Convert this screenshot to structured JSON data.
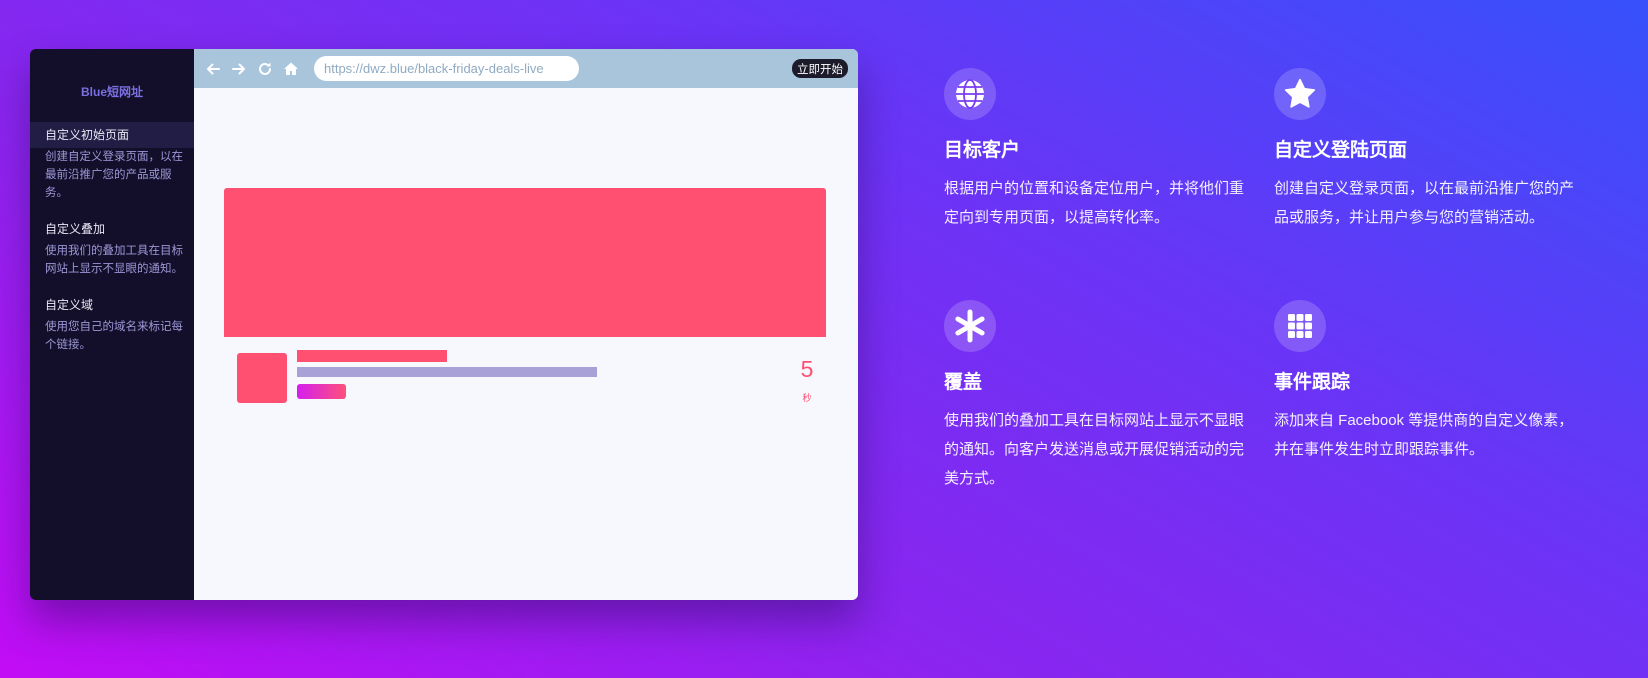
{
  "sidebar": {
    "brand": "Blue短网址",
    "items": [
      {
        "title": "自定义初始页面",
        "desc": "创建自定义登录页面，以在最前沿推广您的产品或服务。"
      },
      {
        "title": "自定义叠加",
        "desc": "使用我们的叠加工具在目标网站上显示不显眼的通知。"
      },
      {
        "title": "自定义域",
        "desc": "使用您自己的域名来标记每个链接。"
      }
    ]
  },
  "browser": {
    "url": "https://dwz.blue/black-friday-deals-live",
    "start_label": "立即开始",
    "icons": [
      "arrow-left-icon",
      "arrow-right-icon",
      "reload-icon",
      "home-icon"
    ]
  },
  "preview": {
    "countdown_number": "5",
    "countdown_unit": "秒",
    "accent": "#ff5072"
  },
  "features": [
    {
      "icon": "globe-icon",
      "title": "目标客户",
      "desc": "根据用户的位置和设备定位用户，并将他们重定向到专用页面，以提高转化率。"
    },
    {
      "icon": "star-icon",
      "title": "自定义登陆页面",
      "desc": "创建自定义登录页面，以在最前沿推广您的产品或服务，并让用户参与您的营销活动。"
    },
    {
      "icon": "asterisk-icon",
      "title": "覆盖",
      "desc": "使用我们的叠加工具在目标网站上显示不显眼的通知。向客户发送消息或开展促销活动的完美方式。"
    },
    {
      "icon": "grid-icon",
      "title": "事件跟踪",
      "desc": "添加来自 Facebook 等提供商的自定义像素，并在事件发生时立即跟踪事件。"
    }
  ]
}
